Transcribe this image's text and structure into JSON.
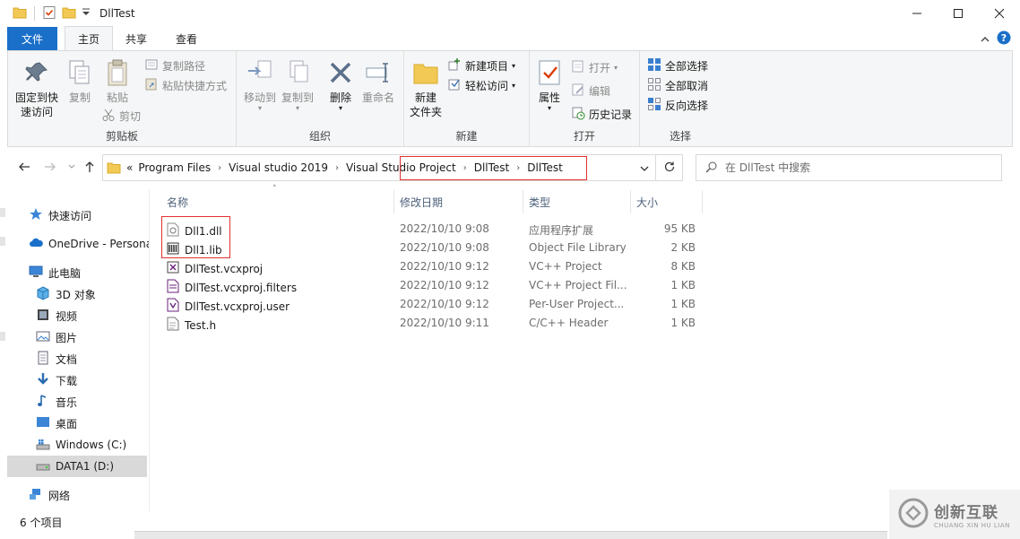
{
  "window": {
    "title": "DllTest"
  },
  "tabs": [
    {
      "label": "文件"
    },
    {
      "label": "主页"
    },
    {
      "label": "共享"
    },
    {
      "label": "查看"
    }
  ],
  "ribbon": {
    "clipboard": {
      "label": "剪贴板",
      "pin": "固定到快速访问",
      "pin_line1": "固定到快",
      "pin_line2": "速访问",
      "copy": "复制",
      "paste": "粘贴",
      "copy_path": "复制路径",
      "paste_shortcut": "粘贴快捷方式",
      "cut": "剪切"
    },
    "organize": {
      "label": "组织",
      "move_to": "移动到",
      "copy_to": "复制到",
      "delete": "删除",
      "rename": "重命名"
    },
    "new": {
      "label": "新建",
      "new_item": "新建项目",
      "easy_access": "轻松访问",
      "new_folder_line1": "新建",
      "new_folder_line2": "文件夹"
    },
    "open": {
      "label": "打开",
      "properties": "属性",
      "open": "打开",
      "edit": "编辑",
      "history": "历史记录"
    },
    "select": {
      "label": "选择",
      "select_all": "全部选择",
      "select_none": "全部取消",
      "invert": "反向选择"
    }
  },
  "address": {
    "overflow": "«",
    "crumbs": [
      "Program Files",
      "Visual studio 2019",
      "Visual Studio Project",
      "DllTest",
      "DllTest"
    ]
  },
  "search": {
    "placeholder": "在 DllTest 中搜索"
  },
  "nav": {
    "quick_access": "快速访问",
    "onedrive": "OneDrive - Persona",
    "this_pc": "此电脑",
    "objects3d": "3D 对象",
    "videos": "视频",
    "pictures": "图片",
    "documents": "文档",
    "downloads": "下载",
    "music": "音乐",
    "desktop": "桌面",
    "drive_c": "Windows (C:)",
    "drive_d": "DATA1 (D:)",
    "network": "网络"
  },
  "columns": {
    "name": "名称",
    "date": "修改日期",
    "type": "类型",
    "size": "大小"
  },
  "files": [
    {
      "name": "Dll1.dll",
      "date": "2022/10/10 9:08",
      "type": "应用程序扩展",
      "size": "95 KB",
      "icon": "dll-file-icon"
    },
    {
      "name": "Dll1.lib",
      "date": "2022/10/10 9:08",
      "type": "Object File Library",
      "size": "2 KB",
      "icon": "lib-file-icon"
    },
    {
      "name": "DllTest.vcxproj",
      "date": "2022/10/10 9:12",
      "type": "VC++ Project",
      "size": "8 KB",
      "icon": "vcxproj-file-icon"
    },
    {
      "name": "DllTest.vcxproj.filters",
      "date": "2022/10/10 9:12",
      "type": "VC++ Project Fil...",
      "size": "1 KB",
      "icon": "filters-file-icon"
    },
    {
      "name": "DllTest.vcxproj.user",
      "date": "2022/10/10 9:12",
      "type": "Per-User Project...",
      "size": "1 KB",
      "icon": "user-file-icon"
    },
    {
      "name": "Test.h",
      "date": "2022/10/10 9:11",
      "type": "C/C++ Header",
      "size": "1 KB",
      "icon": "header-file-icon"
    }
  ],
  "status": {
    "count": "6 个项目"
  },
  "watermark": {
    "text": "创新互联",
    "sub": "CHUANG XIN HU LIAN"
  },
  "colors": {
    "accent": "#1a6fc9",
    "highlight_box": "#e03030",
    "selected_nav": "#d9d9d9"
  }
}
